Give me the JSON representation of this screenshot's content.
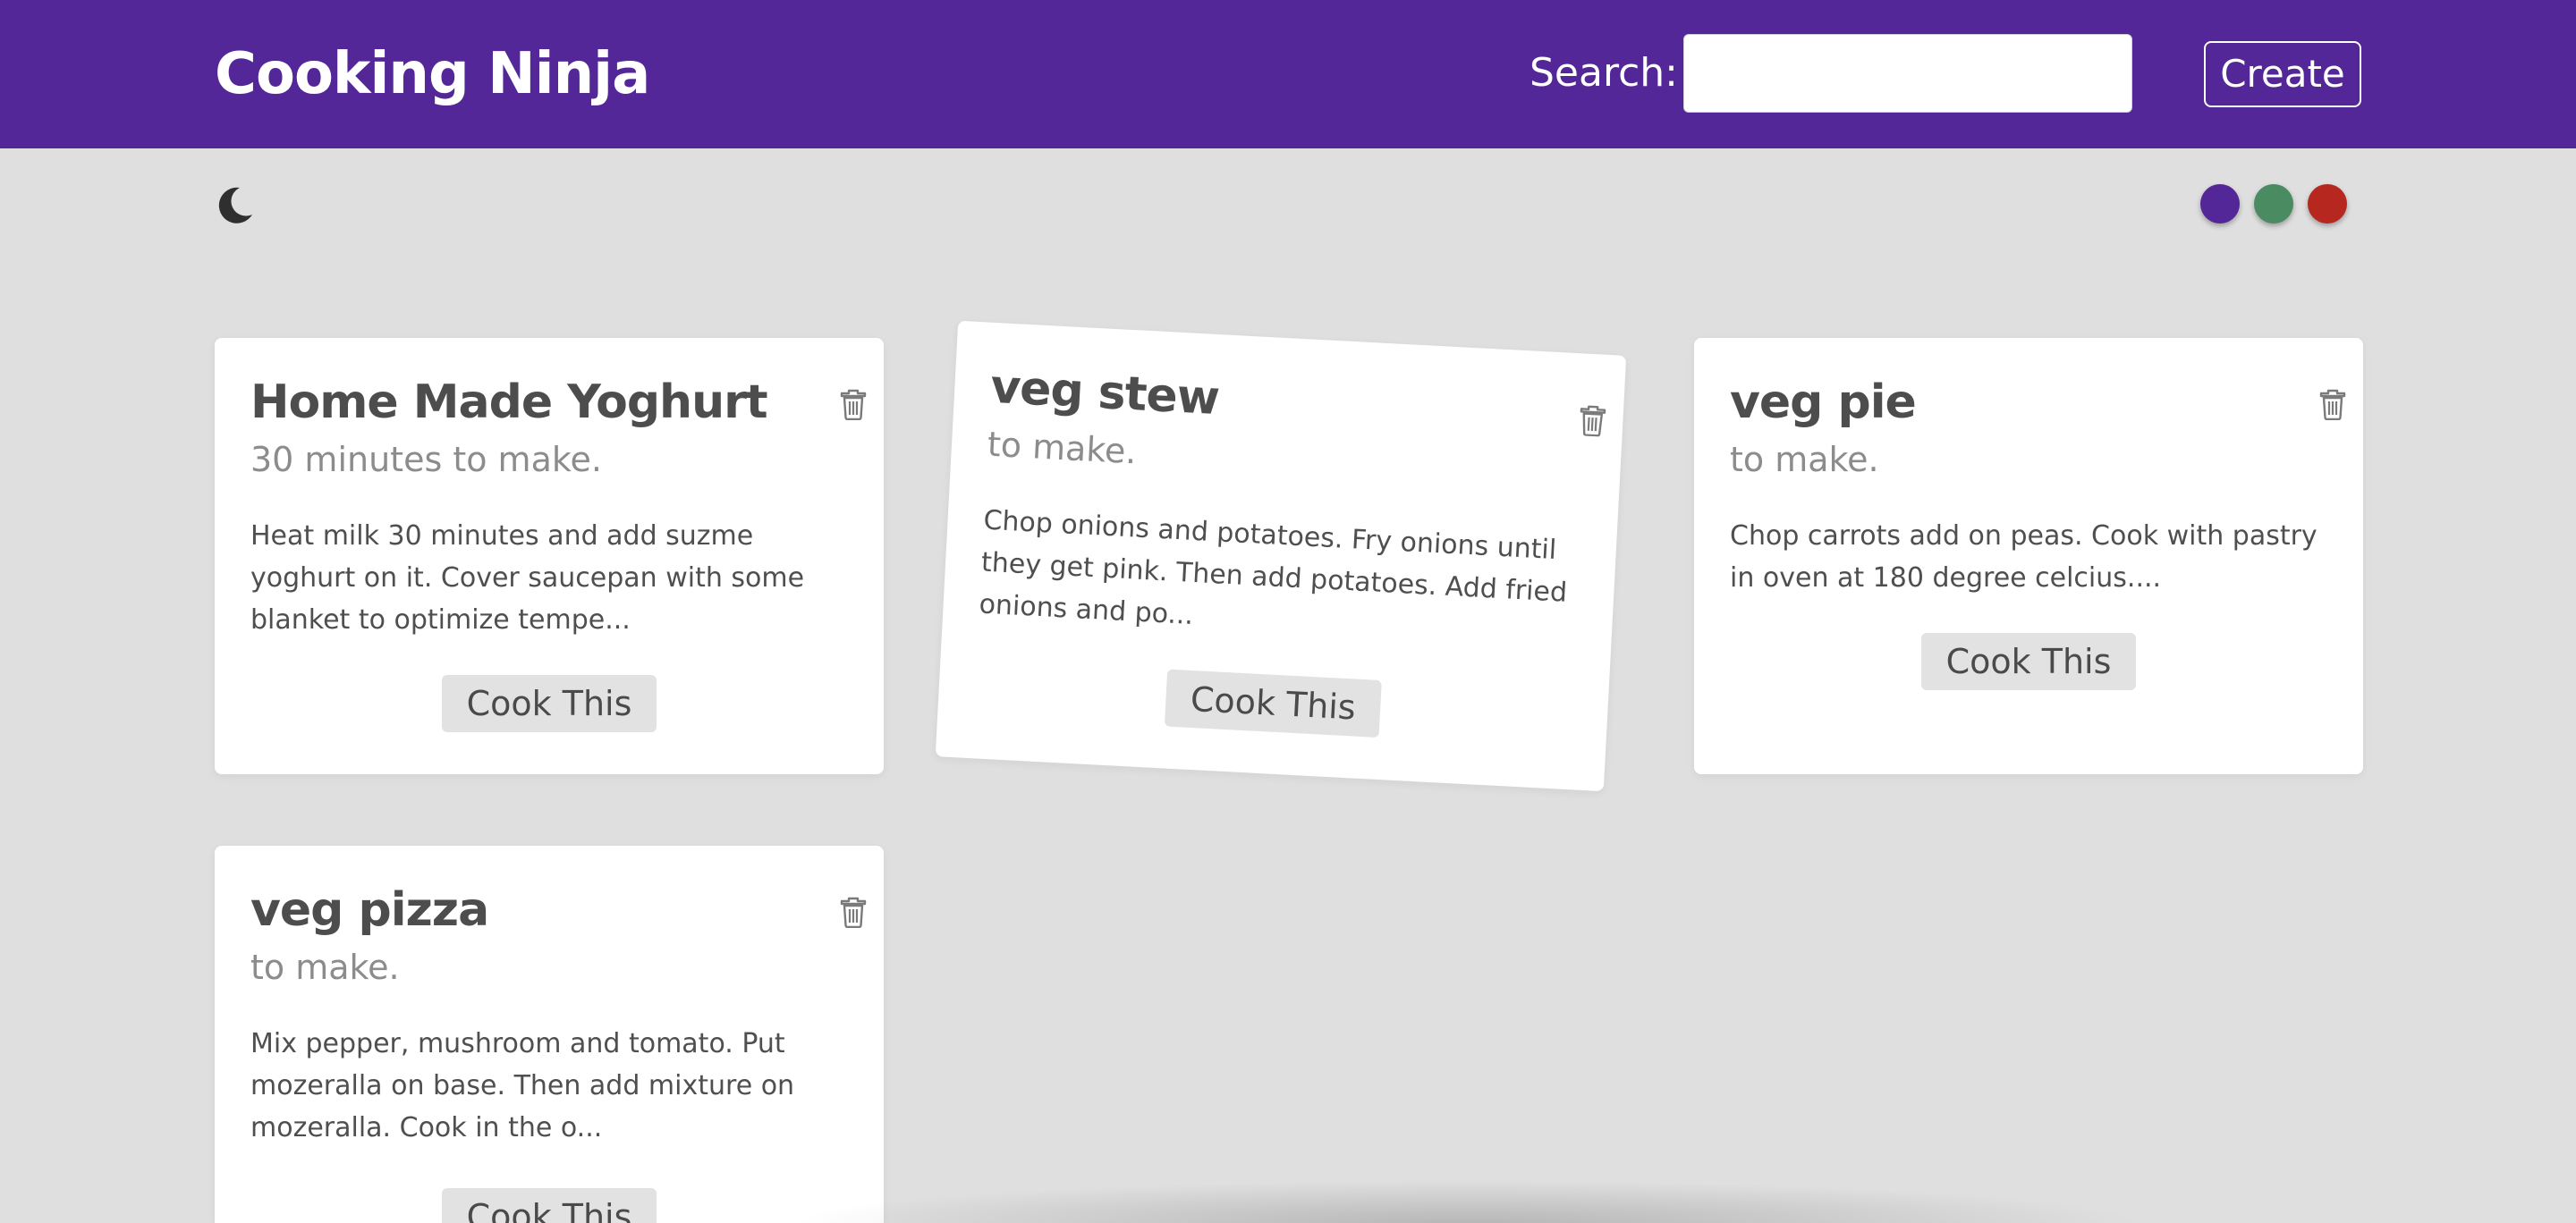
{
  "navbar": {
    "brand": "Cooking Ninja",
    "search_label": "Search:",
    "search_value": "",
    "search_placeholder": "",
    "create_label": "Create",
    "background_color": "#532797"
  },
  "theme": {
    "mode_icon": "moon-icon",
    "colors": [
      "#532797",
      "#4a8b62",
      "#b5271f"
    ]
  },
  "recipes": [
    {
      "title": "Home Made Yoghurt",
      "subtitle": "30 minutes to make.",
      "method": "Heat milk 30 minutes and add suzme yoghurt on it. Cover saucepan with some blanket to optimize tempe...",
      "button": "Cook This"
    },
    {
      "title": "veg stew",
      "subtitle": "to make.",
      "method": "Chop onions and potatoes. Fry onions until they get pink. Then add potatoes. Add fried onions and po...",
      "button": "Cook This"
    },
    {
      "title": "veg pie",
      "subtitle": "to make.",
      "method": "Chop carrots add on peas. Cook with pastry in oven at 180 degree celcius....",
      "button": "Cook This"
    },
    {
      "title": "veg pizza",
      "subtitle": "to make.",
      "method": "Mix pepper, mushroom and tomato. Put mozeralla on base. Then add mixture on mozeralla. Cook in the o...",
      "button": "Cook This"
    }
  ]
}
